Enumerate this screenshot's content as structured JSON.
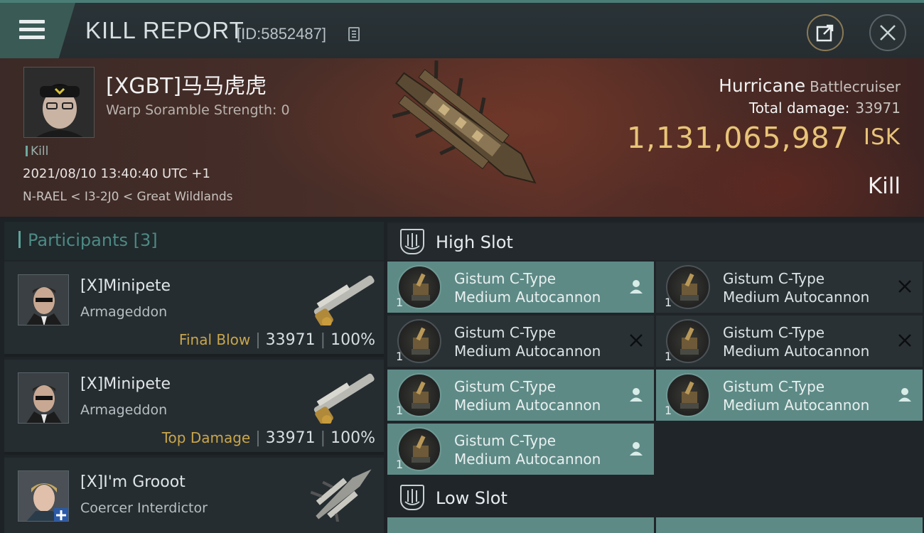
{
  "titlebar": {
    "title": "KILL REPORT",
    "report_id": "[ID:5852487]"
  },
  "victim": {
    "name": "[XGBT]马马虎虎",
    "subtitle": "Warp Soramble Strength: 0",
    "tag": "Kill",
    "datetime": "2021/08/10 13:40:40 UTC +1",
    "location": "N-RAEL < I3-2J0 < Great Wildlands",
    "ship_name": "Hurricane",
    "ship_class": "Battlecruiser",
    "total_damage_label": "Total damage:",
    "total_damage": "33971",
    "isk_value": "1,131,065,987",
    "isk_unit": "ISK",
    "result": "Kill"
  },
  "participants": {
    "label": "Participants",
    "count": "[3]",
    "rows": [
      {
        "name": "[X]Minipete",
        "ship": "Armageddon",
        "role": "Final Blow",
        "damage": "33971",
        "percent": "100%"
      },
      {
        "name": "[X]Minipete",
        "ship": "Armageddon",
        "role": "Top Damage",
        "damage": "33971",
        "percent": "100%"
      },
      {
        "name": "[X]I'm Grooot",
        "ship": "Coercer Interdictor",
        "role": "",
        "damage": "",
        "percent": ""
      }
    ]
  },
  "fitting": {
    "high_slot_label": "High Slot",
    "low_slot_label": "Low Slot",
    "modules": [
      {
        "line1": "Gistum C-Type",
        "line2": "Medium Autocannon",
        "qty": "1",
        "status": "dropped"
      },
      {
        "line1": "Gistum C-Type",
        "line2": "Medium Autocannon",
        "qty": "1",
        "status": "destroyed"
      },
      {
        "line1": "Gistum C-Type",
        "line2": "Medium Autocannon",
        "qty": "1",
        "status": "destroyed"
      },
      {
        "line1": "Gistum C-Type",
        "line2": "Medium Autocannon",
        "qty": "1",
        "status": "destroyed"
      },
      {
        "line1": "Gistum C-Type",
        "line2": "Medium Autocannon",
        "qty": "1",
        "status": "dropped"
      },
      {
        "line1": "Gistum C-Type",
        "line2": "Medium Autocannon",
        "qty": "1",
        "status": "dropped"
      },
      {
        "line1": "Gistum C-Type",
        "line2": "Medium Autocannon",
        "qty": "1",
        "status": "dropped"
      }
    ]
  },
  "colors": {
    "accent": "#5e8a86",
    "isk": "#e8c478",
    "role": "#c9a64a"
  }
}
